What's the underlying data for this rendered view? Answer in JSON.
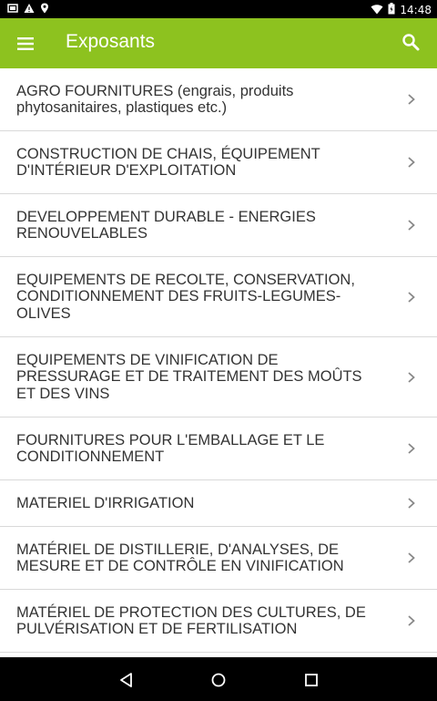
{
  "status_bar": {
    "time": "14:48",
    "icons": [
      "screenshot-icon",
      "warning-icon",
      "location-icon",
      "wifi-icon",
      "battery-icon"
    ]
  },
  "app_bar": {
    "title": "Exposants",
    "background_color": "#8dc21f",
    "menu_icon": "menu-icon",
    "search_icon": "search-icon"
  },
  "list": {
    "items": [
      {
        "label": "AGRO FOURNITURES (engrais, produits phytosanitaires, plastiques etc.)"
      },
      {
        "label": "CONSTRUCTION DE CHAIS, ÉQUIPEMENT D'INTÉRIEUR D'EXPLOITATION"
      },
      {
        "label": "DEVELOPPEMENT DURABLE - ENERGIES RENOUVELABLES"
      },
      {
        "label": "EQUIPEMENTS DE RECOLTE, CONSERVATION, CONDITIONNEMENT DES FRUITS-LEGUMES-OLIVES"
      },
      {
        "label": "EQUIPEMENTS DE VINIFICATION DE PRESSURAGE ET DE TRAITEMENT DES MOÛTS ET DES VINS"
      },
      {
        "label": "FOURNITURES POUR L'EMBALLAGE ET LE CONDITIONNEMENT"
      },
      {
        "label": "MATERIEL D'IRRIGATION"
      },
      {
        "label": "MATÉRIEL DE DISTILLERIE, D'ANALYSES, DE MESURE ET DE CONTRÔLE EN VINIFICATION"
      },
      {
        "label": "MATÉRIEL DE PROTECTION DES CULTURES, DE PULVÉRISATION ET DE FERTILISATION"
      }
    ]
  },
  "nav_bar": {
    "buttons": [
      "back-icon",
      "home-icon",
      "recents-icon"
    ]
  }
}
